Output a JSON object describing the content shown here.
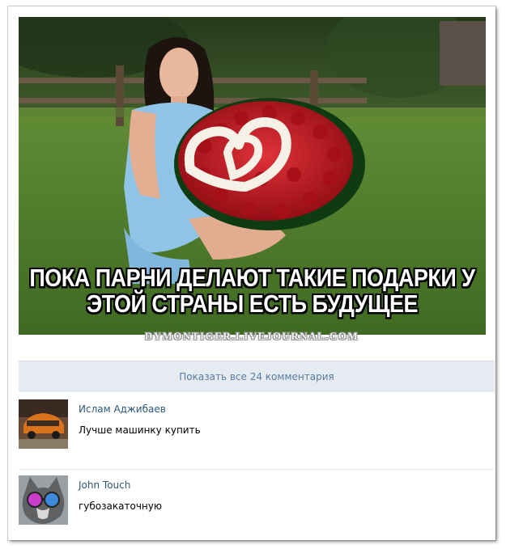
{
  "post": {
    "caption_line1": "ПОКА ПАРНИ ДЕЛАЮТ ТАКИЕ ПОДАРКИ У",
    "caption_line2": "ЭТОЙ СТРАНЫ ЕСТЬ БУДУЩЕЕ",
    "watermark": "DYMONTIGER.LIVEJOURNAL.COM"
  },
  "comments_bar": {
    "show_all_label": "Показать все 24 комментария"
  },
  "comments": [
    {
      "author": "Ислам Аджибаев",
      "text": "Лучше машинку купить",
      "avatar_icon": "car-photo-avatar"
    },
    {
      "author": "John Touch",
      "text": "губозакаточную",
      "avatar_icon": "cat-sunglasses-avatar"
    }
  ],
  "colors": {
    "link": "#2b587a",
    "show_all_bg": "#e5ebf1",
    "show_all_text": "#577ca1",
    "roses": "#c0141c"
  }
}
